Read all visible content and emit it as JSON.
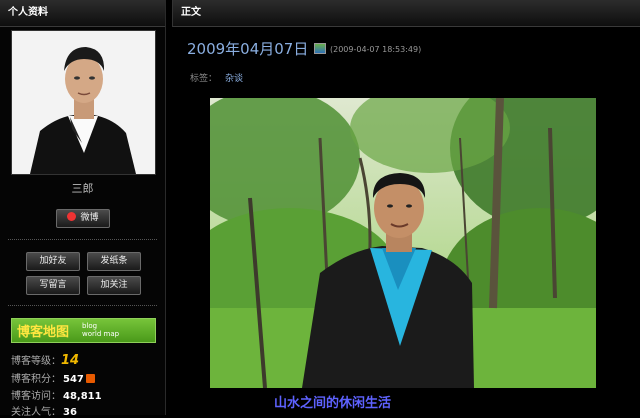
{
  "sidebar": {
    "header": "个人资料",
    "nickname": "三郎",
    "weibo_button": "微博",
    "actions": {
      "add_friend": "加好友",
      "send_note": "发纸条",
      "leave_message": "写留言",
      "follow": "加关注"
    },
    "map_banner": {
      "title": "博客地图",
      "sub1": "blog",
      "sub2": "world map"
    },
    "stats": [
      {
        "label": "博客等级：",
        "value": "14"
      },
      {
        "label": "博客积分：",
        "value": "547"
      },
      {
        "label": "博客访问：",
        "value": "48,811"
      },
      {
        "label": "关注人气：",
        "value": "36"
      }
    ]
  },
  "main": {
    "header": "正文",
    "title": "2009年04月07日",
    "timestamp": "(2009-04-07 18:53:49)",
    "tag_label": "标签：",
    "tag": "杂谈",
    "caption": "山水之间的休闲生活"
  },
  "colors": {
    "accent_link": "#8aaee0",
    "caption": "#5e62ff",
    "map_banner": "#5aa828"
  }
}
